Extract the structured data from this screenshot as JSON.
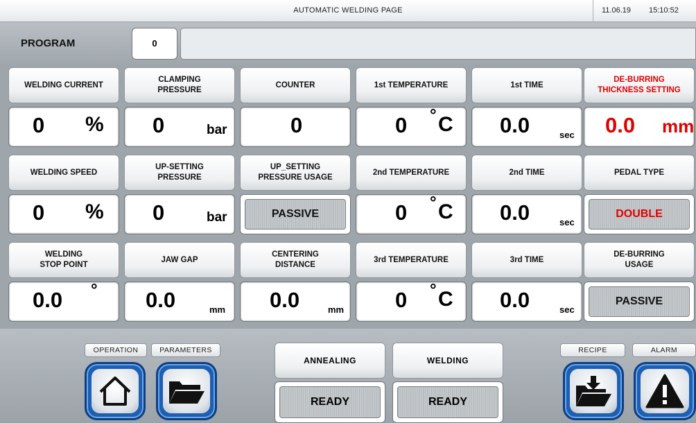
{
  "header": {
    "title": "AUTOMATIC WELDING PAGE",
    "date": "11.06.19",
    "time": "15:10:52"
  },
  "program": {
    "label": "PROGRAM",
    "value": "0",
    "name": ""
  },
  "cells": {
    "welding_current": {
      "label": "WELDING CURRENT",
      "value": "0",
      "unit": "%"
    },
    "clamping_pressure": {
      "label_l1": "CLAMPING",
      "label_l2": "PRESSURE",
      "value": "0",
      "unit": "bar"
    },
    "counter": {
      "label": "COUNTER",
      "value": "0"
    },
    "temp1": {
      "label": "1st TEMPERATURE",
      "value": "0",
      "unit_deg": "°",
      "unit": "C"
    },
    "time1": {
      "label": "1st TIME",
      "value": "0.0",
      "unit": "sec"
    },
    "deburring_thickness": {
      "label_l1": "DE-BURRING",
      "label_l2": "THICKNESS SETTING",
      "value": "0.0",
      "unit": "mm",
      "color": "#e00000"
    },
    "welding_speed": {
      "label": "WELDING SPEED",
      "value": "0",
      "unit": "%"
    },
    "upsetting_pressure": {
      "label_l1": "UP-SETTING",
      "label_l2": "PRESSURE",
      "value": "0",
      "unit": "bar"
    },
    "upsetting_usage": {
      "label_l1": "UP_SETTING",
      "label_l2": "PRESSURE USAGE",
      "state": "PASSIVE"
    },
    "temp2": {
      "label": "2nd TEMPERATURE",
      "value": "0",
      "unit_deg": "°",
      "unit": "C"
    },
    "time2": {
      "label": "2nd TIME",
      "value": "0.0",
      "unit": "sec"
    },
    "pedal_type": {
      "label": "PEDAL TYPE",
      "state": "DOUBLE",
      "color": "#e00000"
    },
    "welding_stop": {
      "label_l1": "WELDING",
      "label_l2": "STOP POINT",
      "value": "0.0",
      "unit": "°"
    },
    "jaw_gap": {
      "label": "JAW GAP",
      "value": "0.0",
      "unit": "mm"
    },
    "centering_distance": {
      "label_l1": "CENTERING",
      "label_l2": "DISTANCE",
      "value": "0.0",
      "unit": "mm"
    },
    "temp3": {
      "label": "3rd TEMPERATURE",
      "value": "0",
      "unit_deg": "°",
      "unit": "C"
    },
    "time3": {
      "label": "3rd TIME",
      "value": "0.0",
      "unit": "sec"
    },
    "deburring_usage": {
      "label_l1": "DE-BURRING",
      "label_l2": "USAGE",
      "state": "PASSIVE"
    }
  },
  "bottom": {
    "operation_label": "OPERATION",
    "parameters_label": "PARAMETERS",
    "recipe_label": "RECIPE",
    "alarm_label": "ALARM",
    "annealing": {
      "label": "ANNEALING",
      "state": "READY"
    },
    "welding": {
      "label": "WELDING",
      "state": "READY"
    }
  },
  "icons": {
    "operation": "home-icon",
    "parameters": "folder-icon",
    "recipe": "folder-download-icon",
    "alarm": "warning-icon"
  }
}
